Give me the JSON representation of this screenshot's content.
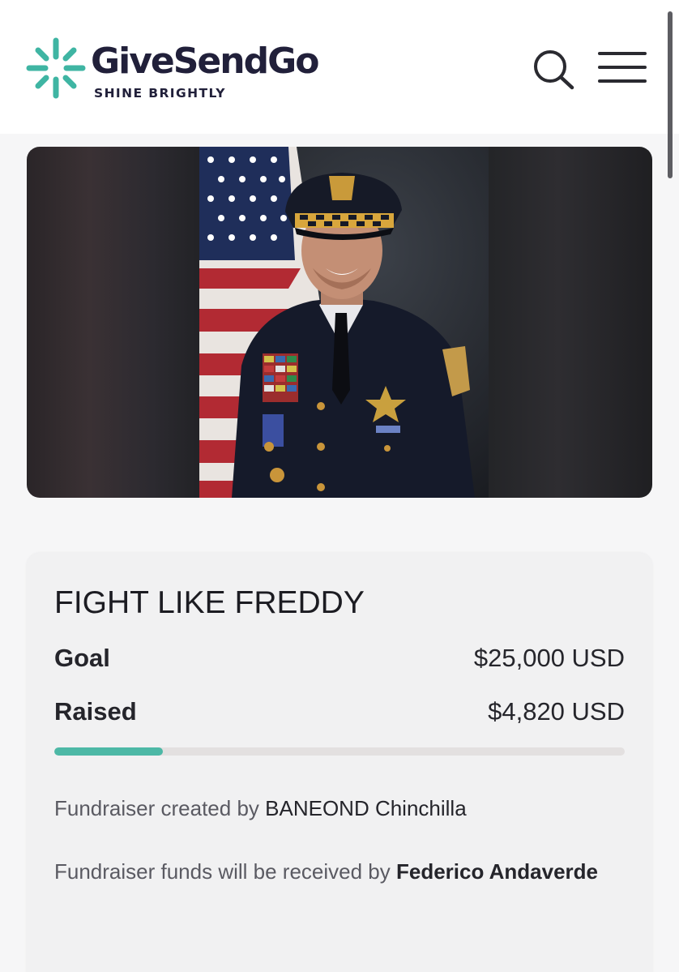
{
  "header": {
    "brand_name": "GiveSendGo",
    "tagline": "SHINE BRIGHTLY",
    "brand_color": "#3fb5a3",
    "search_icon": "search-icon",
    "menu_icon": "hamburger-menu-icon"
  },
  "campaign": {
    "title": "FIGHT LIKE FREDDY",
    "goal_label": "Goal",
    "goal_value": "$25,000 USD",
    "raised_label": "Raised",
    "raised_value": "$4,820 USD",
    "progress_fraction": 0.19,
    "progress_color": "#4db8a6",
    "creator_prefix": "Fundraiser created by",
    "creator_name": "BANEOND Chinchilla",
    "recipient_prefix": "Fundraiser funds will be received by",
    "recipient_name": "Federico Andaverde"
  }
}
